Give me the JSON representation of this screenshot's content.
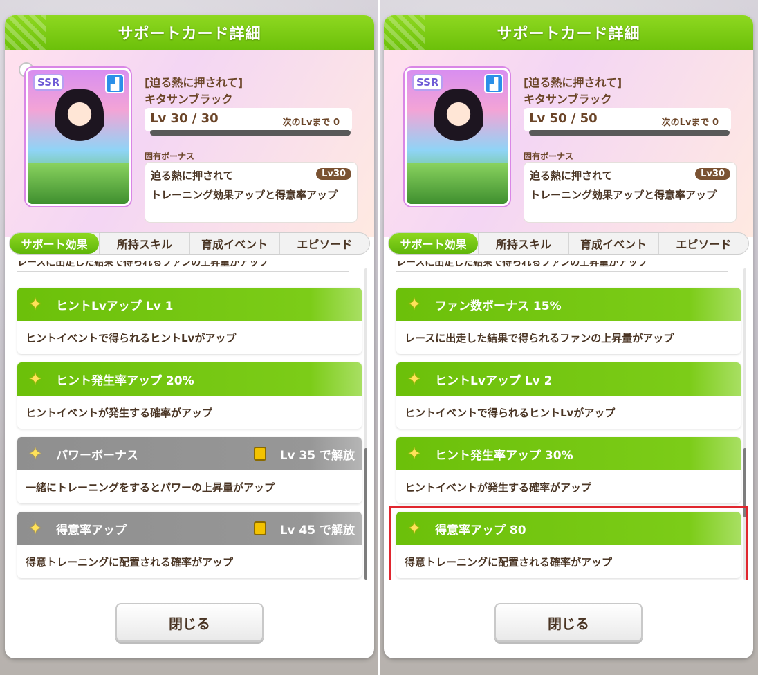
{
  "panels": [
    {
      "header_title": "サポートカード詳細",
      "card": {
        "rarity": "SSR",
        "type_icon": "boot-icon",
        "title": "[迫る熱に押されて]",
        "name": "キタサンブラック",
        "level": "Lv 30 / 30",
        "next_level_label": "次のLvまで 0"
      },
      "unique_bonus": {
        "label": "固有ボーナス",
        "name": "迫る熱に押されて",
        "level_badge": "Lv30",
        "desc": "トレーニング効果アップと得意率アップ"
      },
      "tabs": [
        "サポート効果",
        "所持スキル",
        "育成イベント",
        "エピソード"
      ],
      "partial_row": "レースに出走した結果で得られるファンの上昇量がアップ",
      "effects": [
        {
          "name": "ヒントLvアップ Lv 1",
          "desc": "ヒントイベントで得られるヒントLvがアップ",
          "unlock": ""
        },
        {
          "name": "ヒント発生率アップ 20%",
          "desc": "ヒントイベントが発生する確率がアップ",
          "unlock": ""
        },
        {
          "name": "パワーボーナス",
          "desc": "一緒にトレーニングをするとパワーの上昇量がアップ",
          "unlock": "Lv 35 で解放"
        },
        {
          "name": "得意率アップ",
          "desc": "得意トレーニングに配置される確率がアップ",
          "unlock": "Lv 45 で解放"
        }
      ],
      "close_label": "閉じる"
    },
    {
      "header_title": "サポートカード詳細",
      "card": {
        "rarity": "SSR",
        "type_icon": "boot-icon",
        "title": "[迫る熱に押されて]",
        "name": "キタサンブラック",
        "level": "Lv 50 / 50",
        "next_level_label": "次のLvまで 0"
      },
      "unique_bonus": {
        "label": "固有ボーナス",
        "name": "迫る熱に押されて",
        "level_badge": "Lv30",
        "desc": "トレーニング効果アップと得意率アップ"
      },
      "tabs": [
        "サポート効果",
        "所持スキル",
        "育成イベント",
        "エピソード"
      ],
      "partial_row": "レースに出走した結果で得られるファンの上昇量がアップ",
      "effects": [
        {
          "name": "ファン数ボーナス 15%",
          "desc": "レースに出走した結果で得られるファンの上昇量がアップ",
          "unlock": ""
        },
        {
          "name": "ヒントLvアップ Lv 2",
          "desc": "ヒントイベントで得られるヒントLvがアップ",
          "unlock": ""
        },
        {
          "name": "ヒント発生率アップ 30%",
          "desc": "ヒントイベントが発生する確率がアップ",
          "unlock": ""
        },
        {
          "name": "得意率アップ 80",
          "desc": "得意トレーニングに配置される確率がアップ",
          "unlock": ""
        }
      ],
      "close_label": "閉じる"
    }
  ],
  "colors": {
    "accent_green": "#6cc00a",
    "locked_gray": "#8f8f8f",
    "text_brown": "#4a3524",
    "highlight_red": "#e0262e"
  }
}
